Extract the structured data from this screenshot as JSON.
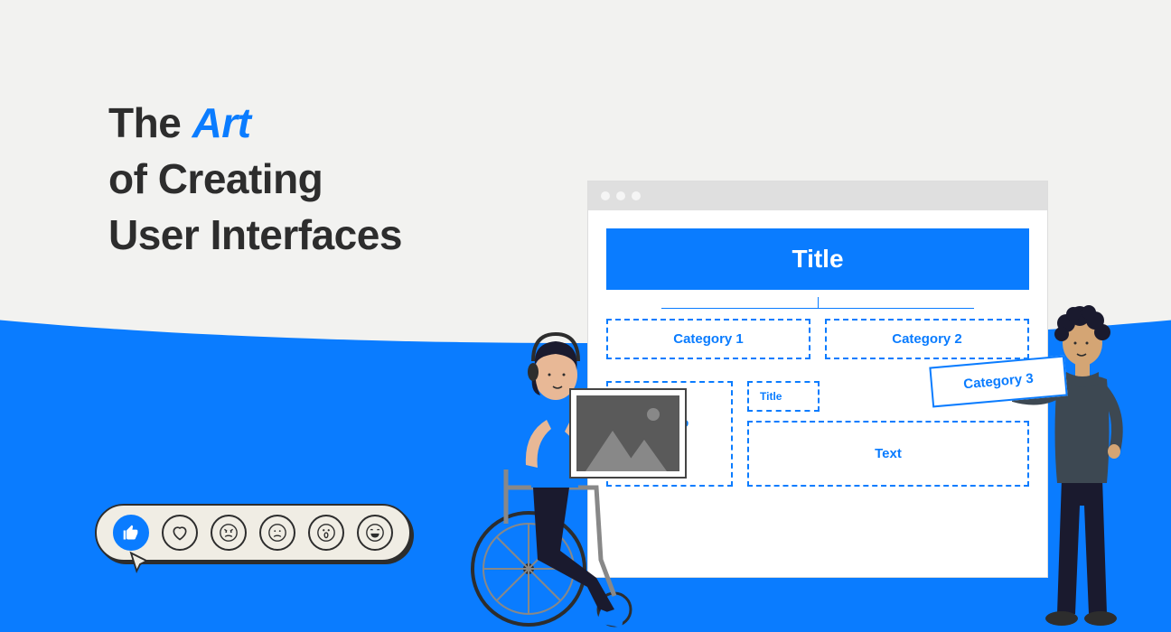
{
  "heading": {
    "part1": "The ",
    "accent": "Art",
    "part2": "of Creating",
    "part3": "User Interfaces"
  },
  "reactions": {
    "like": "👍",
    "love": "♡",
    "angry": "😠",
    "sad": "☹",
    "wow": "😮",
    "laugh": "😆"
  },
  "wireframe": {
    "title": "Title",
    "categories": [
      "Category 1",
      "Category 2",
      "Category 3"
    ],
    "photo_label": "Photo",
    "small_title": "Title",
    "text_label": "Text"
  },
  "colors": {
    "accent": "#0a7cff",
    "dark": "#2d2d2d",
    "bg": "#f2f2f0"
  }
}
